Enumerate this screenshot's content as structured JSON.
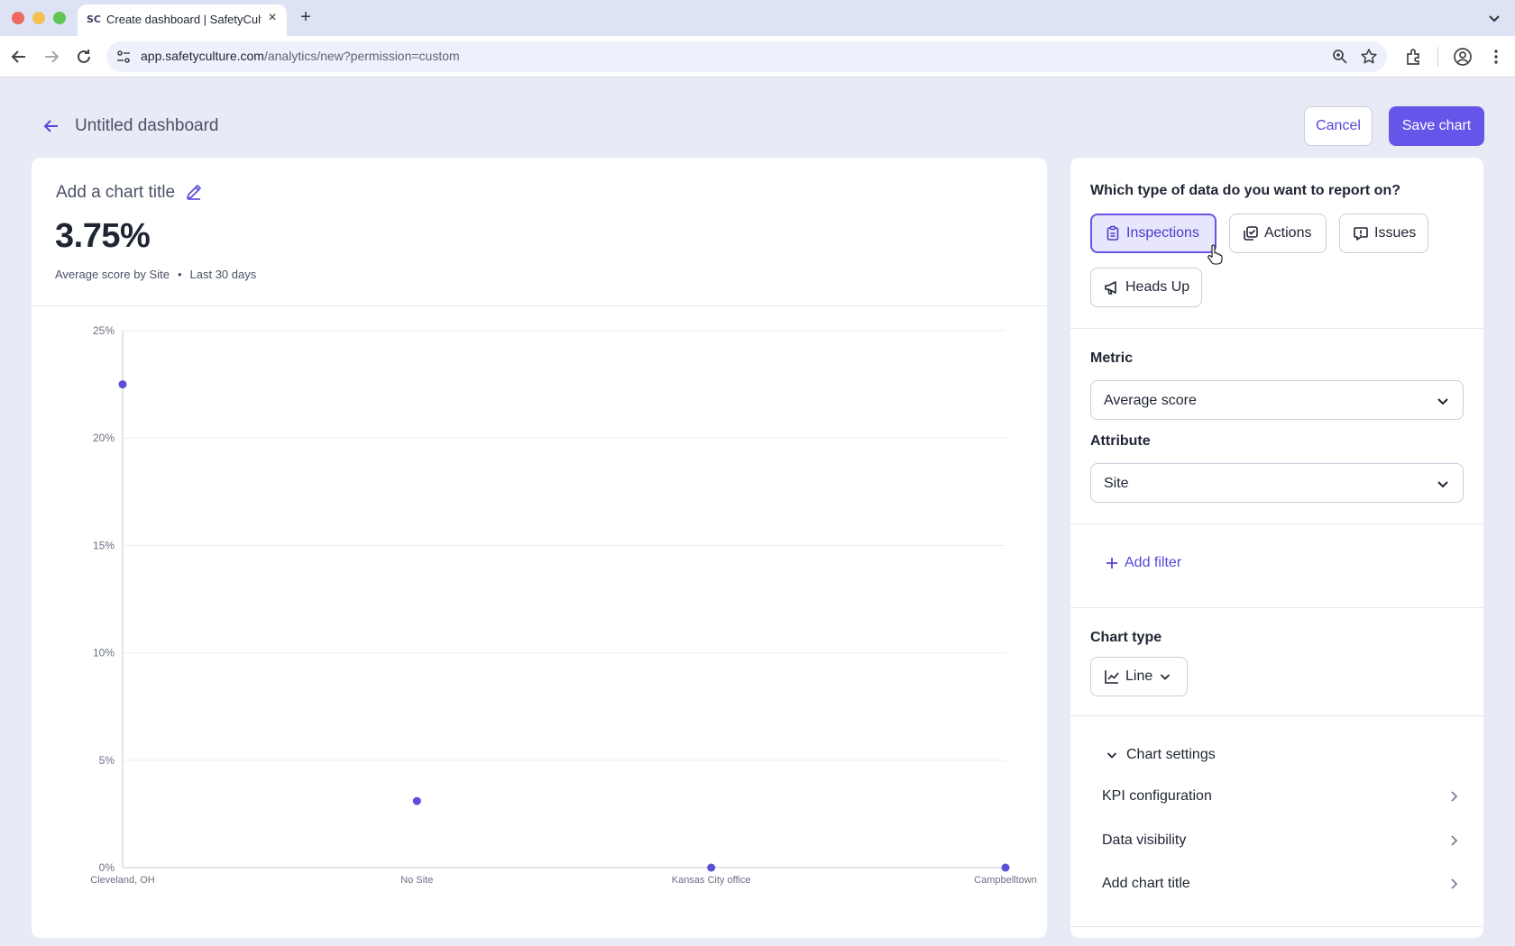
{
  "browser": {
    "tab_title": "Create dashboard | SafetyCulture",
    "tab_favicon": "SC",
    "url_host": "app.safetyculture.com",
    "url_path": "/analytics/new?permission=custom"
  },
  "header": {
    "title": "Untitled dashboard",
    "cancel_label": "Cancel",
    "save_label": "Save chart"
  },
  "chart_panel": {
    "title_placeholder": "Add a chart title",
    "kpi_value": "3.75%",
    "kpi_metric": "Average score by Site",
    "kpi_period": "Last 30 days"
  },
  "config": {
    "question": "Which type of data do you want to report on?",
    "data_types": [
      {
        "label": "Inspections",
        "icon": "clipboard-icon",
        "active": true
      },
      {
        "label": "Actions",
        "icon": "checkbox-stack-icon",
        "active": false
      },
      {
        "label": "Issues",
        "icon": "alert-bubble-icon",
        "active": false
      },
      {
        "label": "Heads Up",
        "icon": "megaphone-icon",
        "active": false
      }
    ],
    "metric_label": "Metric",
    "metric_value": "Average score",
    "attribute_label": "Attribute",
    "attribute_value": "Site",
    "add_filter_label": "Add filter",
    "chart_type_label": "Chart type",
    "chart_type_value": "Line",
    "chart_settings_label": "Chart settings",
    "settings_rows": [
      "KPI configuration",
      "Data visibility",
      "Add chart title"
    ]
  },
  "colors": {
    "accent": "#6556e9",
    "accent_text": "#5548d9",
    "point": "#5a4fd6"
  },
  "chart_data": {
    "type": "scatter",
    "categories": [
      "Cleveland, OH",
      "No Site",
      "Kansas City office",
      "Campbelltown"
    ],
    "values": [
      22.5,
      3.1,
      0,
      0
    ],
    "y_ticks": [
      "0%",
      "5%",
      "10%",
      "15%",
      "20%",
      "25%"
    ],
    "ylim": [
      0,
      25
    ],
    "grid": true,
    "xlabel": "",
    "ylabel": ""
  }
}
